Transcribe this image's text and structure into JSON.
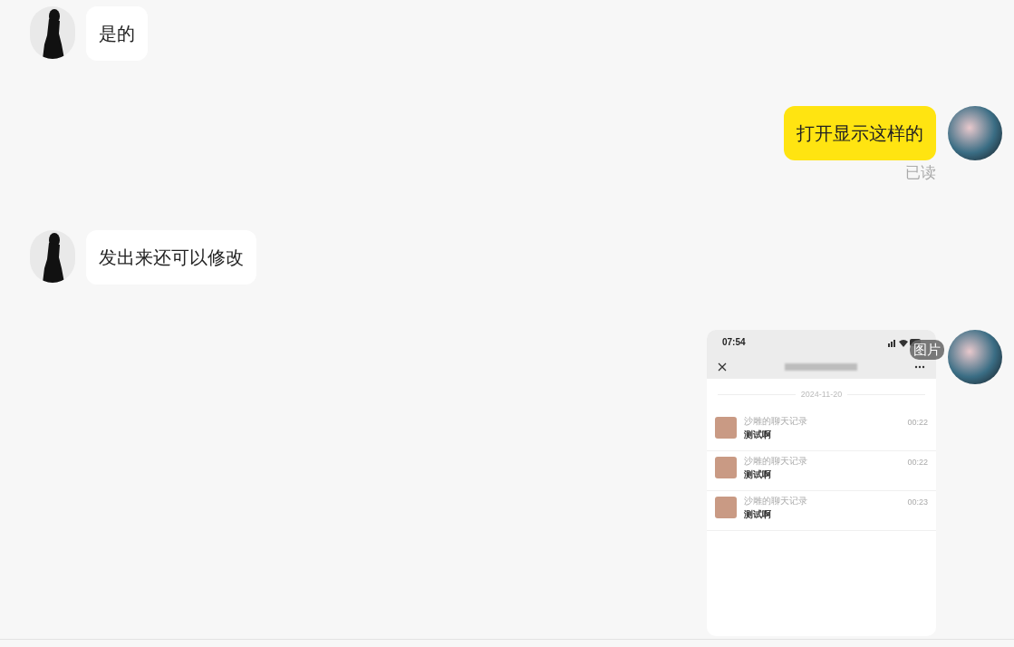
{
  "messages": [
    {
      "kind": "text",
      "outgoing": false,
      "text": "是的"
    },
    {
      "kind": "text",
      "outgoing": true,
      "text": "打开显示这样的",
      "read_status": "已读"
    },
    {
      "kind": "text",
      "outgoing": false,
      "text": "发出来还可以修改"
    },
    {
      "kind": "image",
      "outgoing": true,
      "badge": "图片",
      "screenshot": {
        "status_time": "07:54",
        "date": "2024-11-20",
        "records": [
          {
            "title": "沙雕的聊天记录",
            "time": "00:22",
            "preview": "测试啊"
          },
          {
            "title": "沙雕的聊天记录",
            "time": "00:22",
            "preview": "测试啊"
          },
          {
            "title": "沙雕的聊天记录",
            "time": "00:23",
            "preview": "测试啊"
          }
        ]
      }
    }
  ]
}
